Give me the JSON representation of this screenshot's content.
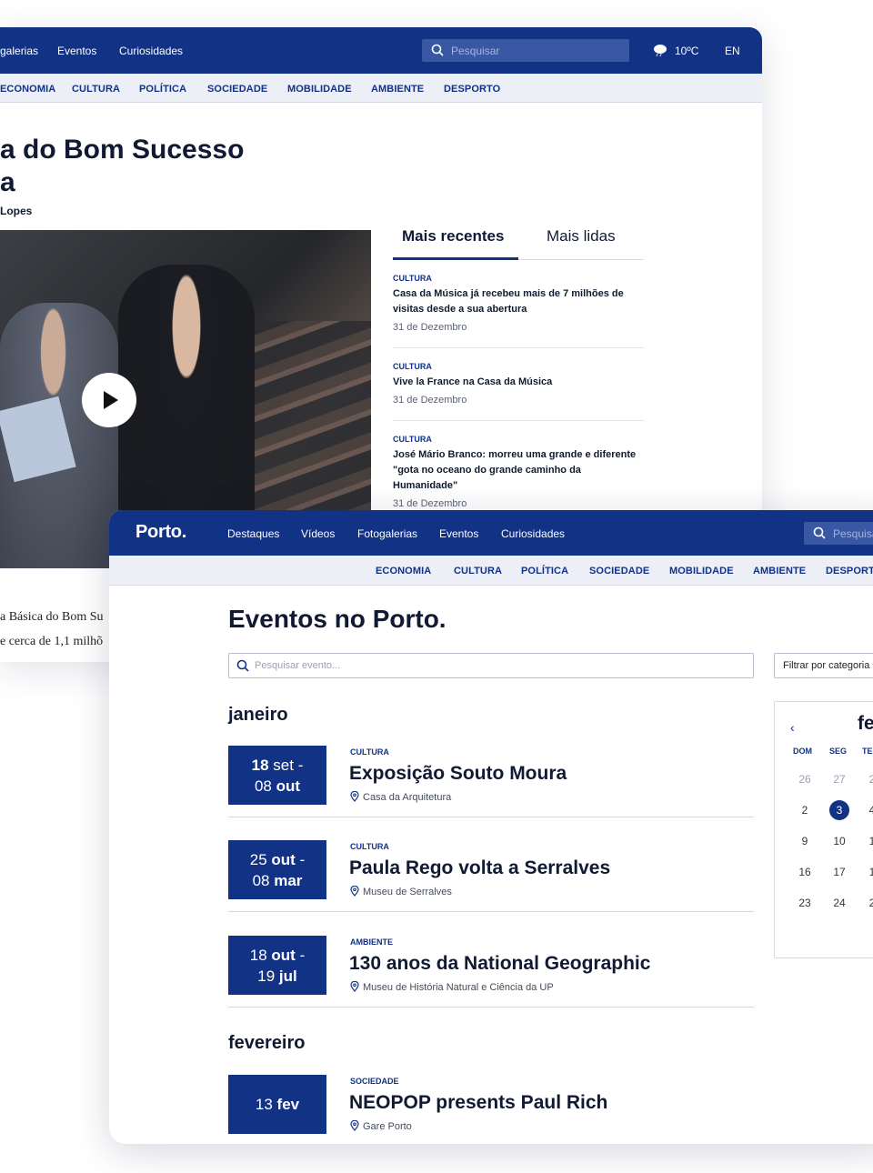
{
  "back": {
    "nav": [
      "galerias",
      "Eventos",
      "Curiosidades"
    ],
    "search_placeholder": "Pesquisar",
    "weather": "10ºC",
    "lang": "EN",
    "categories": [
      "ECONOMIA",
      "CULTURA",
      "POLÍTICA",
      "SOCIEDADE",
      "MOBILIDADE",
      "AMBIENTE",
      "DESPORTO"
    ],
    "headline": [
      "a do Bom Sucesso",
      "a"
    ],
    "author": "Lopes",
    "tabs": [
      "Mais recentes",
      "Mais lidas"
    ],
    "recent": [
      {
        "cat": "CULTURA",
        "title": "Casa da Música já recebeu mais de 7 milhões de visitas desde a sua abertura",
        "date": "31 de Dezembro"
      },
      {
        "cat": "CULTURA",
        "title": "Vive la France na Casa da Música",
        "date": "31 de Dezembro"
      },
      {
        "cat": "CULTURA",
        "title": "José Mário Branco: morreu uma grande e diferente \"gota no oceano do grande caminho da Humanidade\"",
        "date": "31 de Dezembro"
      }
    ],
    "body": [
      "a Básica do Bom Su",
      "e cerca de 1,1 milhõ"
    ]
  },
  "front": {
    "logo": "Porto.",
    "nav": [
      "Destaques",
      "Vídeos",
      "Fotogalerias",
      "Eventos",
      "Curiosidades"
    ],
    "search_placeholder": "Pesquisa",
    "categories": [
      "ECONOMIA",
      "CULTURA",
      "POLÍTICA",
      "SOCIEDADE",
      "MOBILIDADE",
      "AMBIENTE",
      "DESPORTO"
    ],
    "title": "Eventos no Porto.",
    "event_search_placeholder": "Pesquisar evento...",
    "filter": "Filtrar por categoria",
    "months": [
      "janeiro",
      "fevereiro"
    ],
    "events": [
      {
        "d1": "18",
        "m1": "set",
        "d2": "08",
        "m2": "out",
        "cat": "CULTURA",
        "title": "Exposição Souto Moura",
        "loc": "Casa da Arquitetura"
      },
      {
        "d1": "25",
        "m1": "out",
        "d2": "08",
        "m2": "mar",
        "cat": "CULTURA",
        "title": "Paula Rego volta a Serralves",
        "loc": "Museu de Serralves"
      },
      {
        "d1": "18",
        "m1": "out",
        "d2": "19",
        "m2": "jul",
        "cat": "AMBIENTE",
        "title": "130 anos da National Geographic",
        "loc": "Museu de História Natural e Ciência da UP"
      },
      {
        "d1": "13",
        "m1": "fev",
        "cat": "SOCIEDADE",
        "title": "NEOPOP presents Paul Rich",
        "loc": "Gare Porto"
      }
    ],
    "calendar": {
      "prev": "‹",
      "month": "fe",
      "dow": [
        "DOM",
        "SEG",
        "TE"
      ],
      "rows": [
        [
          "26",
          "27",
          "2"
        ],
        [
          "2",
          "3",
          "4"
        ],
        [
          "9",
          "10",
          "1"
        ],
        [
          "16",
          "17",
          "1"
        ],
        [
          "23",
          "24",
          "2"
        ]
      ],
      "selected": "3"
    }
  },
  "colors": {
    "brand": "#123286",
    "search_bg": "#3a57a3",
    "category_bar": "#eceff5"
  }
}
